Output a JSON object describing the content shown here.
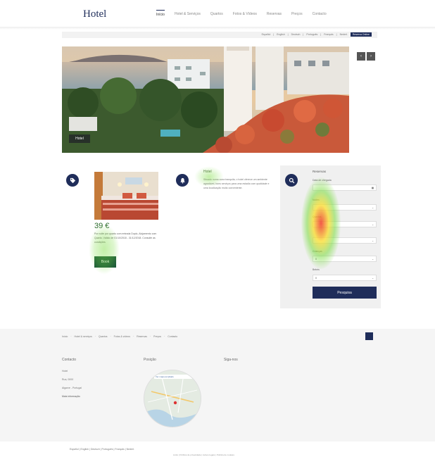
{
  "header": {
    "logo": "Hotel",
    "nav": [
      "Início",
      "Hotel & Serviços",
      "Quartos",
      "Fotos & Vídeos",
      "Reservas",
      "Preços",
      "Contacto"
    ]
  },
  "languages": {
    "items": [
      "Español",
      "English",
      "Deutsch",
      "Português",
      "Français",
      "Nederl."
    ],
    "button": "Reserva Online"
  },
  "hero": {
    "tag": "Hotel",
    "prev": "‹",
    "next": "›"
  },
  "offer": {
    "icon": "tag-icon",
    "price": "39 €",
    "text": "Por noite por quarto com entrada Duplo, Alojamento com Quarto. Válido de 01/10/2018 - 31/12/2018. Consulte as condições",
    "book_label": "Book"
  },
  "hotel": {
    "icon": "bell-icon",
    "title": "Hotel",
    "text": "Situado numa zona tranquila, o hotel oferece um ambiente agradável, bons serviços para uma estadia com qualidade e uma localização muito conveniente."
  },
  "search": {
    "icon": "search-icon",
    "title": "Reservas",
    "fields": [
      {
        "label": "Data de chegada",
        "value": "",
        "icon": "calendar-icon"
      },
      {
        "label": "Noites",
        "value": "",
        "icon": "chevron-down-icon"
      },
      {
        "label": "Quartos",
        "value": "",
        "icon": "chevron-down-icon"
      },
      {
        "label": "",
        "value": "",
        "icon": "chevron-down-icon"
      },
      {
        "label": "Crianças",
        "value": "0",
        "icon": "chevron-down-icon"
      },
      {
        "label": "Bebés",
        "value": "0",
        "icon": "chevron-down-icon"
      }
    ],
    "button": "Pesquisa"
  },
  "footer": {
    "nav": [
      "Início",
      "Hotel & serviços",
      "Quartos",
      "Fotos & vídeos",
      "Reservas",
      "Preços",
      "Contacto"
    ],
    "contact_title": "Contacto",
    "position_title": "Posição",
    "follow_title": "Siga-nos",
    "contact_lines": [
      "Hotel",
      "Rua, 0000",
      "Algarve - Portugal",
      "Mais informação"
    ],
    "map_label": "Ver mapa ampliado",
    "bottom_links": "Español  |  English  |  Deutsch  |  Português  |  Français  |  Nederl.",
    "bottom_sub": "Links  |  Política de privacidade  |  Avisos legais  |  Política de cookies"
  },
  "colors": {
    "brand": "#1f2d5a",
    "book": "#1d5a3a",
    "price": "#2a6b2a"
  }
}
